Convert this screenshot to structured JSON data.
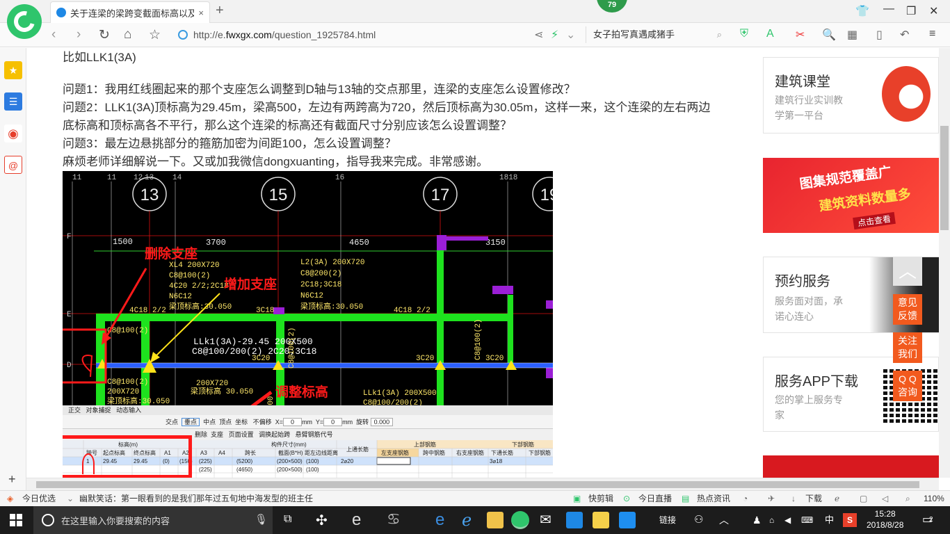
{
  "browser": {
    "tab_title": "关于连梁的梁跨变截面标高以及…",
    "tab_close": "×",
    "new_tab": "+",
    "badge": "79",
    "url_prefix": "http://e.",
    "url_domain": "fwxgx.com",
    "url_path": "/question_1925784.html",
    "search_text": "女子拍写真遇咸猪手"
  },
  "article": {
    "intro": "比如LLK1(3A)",
    "q1": "问题1：我用红线圈起来的那个支座怎么调整到D轴与13轴的交点那里，连梁的支座怎么设置修改？",
    "q2": "问题2：LLK1(3A)顶标高为29.45m，梁高500，左边有两跨高为720，然后顶标高为30.05m，这样一来，这个连梁的左右两边底标高和顶标高各不平行，那么这个连梁的标高还有截面尺寸分别应该怎么设置调整？",
    "q3": "问题3：最左边悬挑部分的箍筋加密为间距100，怎么设置调整？",
    "closing": "麻烦老师详细解说一下。又或加我微信dongxuanting，指导我来完成。非常感谢。"
  },
  "cad": {
    "axis_top": [
      "11",
      "11",
      "12",
      "13",
      "14",
      "16",
      "1818"
    ],
    "axis_circles": [
      "13",
      "15",
      "17",
      "19"
    ],
    "dims": [
      "1500",
      "3700",
      "4650",
      "3150"
    ],
    "row_labels": [
      "F",
      "E",
      "D"
    ],
    "annotation_delete": "删除支座",
    "annotation_add": "增加支座",
    "annotation_adjust": "调整标高",
    "beam_xl4": [
      "XL4 200X720",
      "C8@100(2)",
      "4C20 2/2;2C18",
      "N6C12",
      "梁顶标高:30.050"
    ],
    "beam_l2": [
      "L2(3A) 200X720",
      "C8@200(2)",
      "2C18;3C18",
      "N6C12",
      "梁顶标高:30.050"
    ],
    "beam_llk1_top": [
      "LLk1(3A)-29.45 200X500",
      "C8@100/200(2) 2C20;3C18"
    ],
    "beam_llk1_right": [
      "LLk1(3A) 200X500",
      "C8@100/200(2)"
    ],
    "misc_labels": [
      "4C18 2/2",
      "3C18",
      "4C18 2/2",
      "C8@100(2)",
      "C8@100(2)",
      "200X720",
      "梁顶标高:30.050",
      "200X720",
      "梁顶标高 30.050",
      "3C20",
      "3C20",
      "3C20",
      "C8@100(2)",
      "C8@100(2)",
      "1500"
    ],
    "toolbar1": [
      "正交",
      "对象捕捉",
      "动态输入"
    ],
    "toolbar2": [
      "交点",
      "垂点",
      "中点",
      "顶点",
      "坐标",
      "不偏移",
      "X=",
      "0",
      "mm",
      "Y=",
      "0",
      "mm",
      "旋转",
      "0.000"
    ],
    "grid_menu": [
      "删除",
      "支座",
      "页面设置",
      "调换起始跨",
      "悬臂钢筋代号"
    ],
    "grid_headers": [
      "跨号",
      "标高(m)",
      "起点标高",
      "终点标高",
      "A1",
      "A2",
      "A3",
      "A4",
      "构件尺寸(mm)",
      "跨长",
      "截面(B*H)",
      "距左边线距离",
      "上通长筋",
      "上部钢筋",
      "左支座钢筋",
      "跨中钢筋",
      "右支座钢筋",
      "下部钢筋",
      "下通长筋",
      "下部钢筋"
    ],
    "grid_row1": [
      "1",
      "29.45",
      "29.45",
      "(0)",
      "(150)",
      "(225)",
      "(5200)",
      "(200×500)",
      "(100)",
      "2⌀20",
      "3⌀18"
    ],
    "grid_row2": [
      "(225)",
      "(4650)",
      "(200×500)",
      "(100)"
    ]
  },
  "right": {
    "card1_title": "建筑课堂",
    "card1_sub1": "建筑行业实训教",
    "card1_sub2": "学第一平台",
    "banner_line1": "图集规范覆盖广",
    "banner_line2": "建筑资料数量多",
    "banner_btn": "点击查看",
    "card2_title": "预约服务",
    "card2_sub1": "服务面对面，承",
    "card2_sub2": "诺心连心",
    "card3_title": "服务APP下载",
    "card3_sub1": "您的掌上服务专",
    "card3_sub2": "家",
    "float1a": "意见",
    "float1b": "反馈",
    "float2a": "关注",
    "float2b": "我们",
    "float3a": "Q Q",
    "float3b": "咨询"
  },
  "statusbar": {
    "today": "今日优选",
    "headline": "幽默笑话：第一眼看到的是我们那年过五旬地中海发型的班主任",
    "kuaijianji": "快剪辑",
    "live": "今日直播",
    "hot": "热点资讯",
    "download": "下载",
    "zoom": "110%"
  },
  "taskbar": {
    "search_placeholder": "在这里输入你要搜索的内容",
    "links": "链接",
    "ime": "中",
    "time": "15:28",
    "date": "2018/8/28",
    "notif": "2"
  },
  "colors": {
    "brand_green": "#2fc56c",
    "cad_green": "#1ee21e",
    "cad_magenta": "#9b1fd6",
    "cad_blue": "#2b5fff",
    "annot_red": "#ff1a1a",
    "cad_yellow": "#ffe21a",
    "orange": "#f25a1e"
  }
}
